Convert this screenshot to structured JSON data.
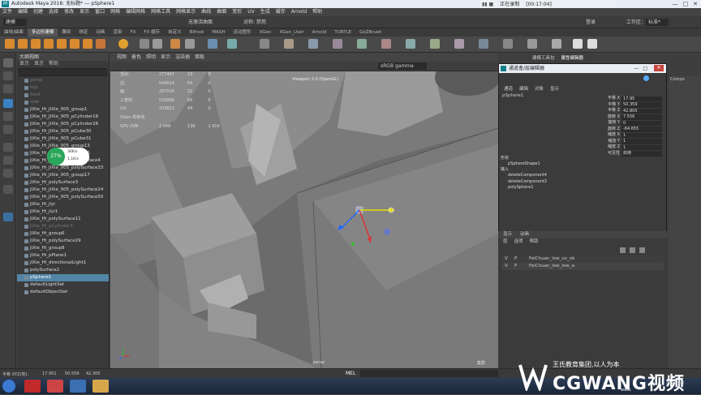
{
  "window": {
    "title": "Autodesk Maya 2018: 无标题*  ---  pSphere1",
    "controls": [
      "—",
      "□",
      "✕"
    ]
  },
  "recorder": {
    "status": "正在录制",
    "time": "[00:17:04]"
  },
  "menubar": [
    "文件",
    "编辑",
    "创建",
    "选择",
    "修改",
    "显示",
    "窗口",
    "网格",
    "编辑网格",
    "网格工具",
    "网格显示",
    "曲线",
    "曲面",
    "变形",
    "UV",
    "生成",
    "缓存",
    "Arnold",
    "帮助"
  ],
  "statusline": {
    "mode": "建模",
    "nolive": "无激活曲面",
    "symmetry": "对称: 禁用",
    "login": "登录",
    "workspace": "工作区：",
    "workspace_value": "标准*"
  },
  "shelf_tabs": [
    "曲线/曲面",
    "多边形建模",
    "雕刻",
    "绑定",
    "动画",
    "渲染",
    "FX",
    "FX 缓存",
    "自定义",
    "Bifrost",
    "MASH",
    "运动图形",
    "XGen",
    "XGen_User",
    "Arnold",
    "TURTLE",
    "GoZBrush"
  ],
  "shelf_active": "多边形建模",
  "outliner": {
    "title": "大纲视图",
    "menu": [
      "显示",
      "显示",
      "帮助"
    ],
    "items": [
      {
        "label": "persp",
        "dim": true
      },
      {
        "label": "top",
        "dim": true
      },
      {
        "label": "front",
        "dim": true
      },
      {
        "label": "side",
        "dim": true
      },
      {
        "label": "JiXie_Hi_JiXie_005_group1"
      },
      {
        "label": "JiXie_Hi_JiXie_005_pCylinder18"
      },
      {
        "label": "JiXie_Hi_JiXie_005_pCylinder26"
      },
      {
        "label": "JiXie_Hi_JiXie_005_pCube30"
      },
      {
        "label": "JiXie_Hi_JiXie_005_pCube31"
      },
      {
        "label": "JiXie_Hi_JiXie_005_group13"
      },
      {
        "label": "JiXie_Hi_JiXie_005_group16"
      },
      {
        "label": "JiXie_Hi_JiXie_005_polySurface4"
      },
      {
        "label": "JiXie_Hi_JiXie_005_polySurface33"
      },
      {
        "label": "JiXie_Hi_JiXie_005_group17"
      },
      {
        "label": "JiXie_Hi_polySurface3"
      },
      {
        "label": "JiXie_Hi_JiXie_005_polySurface24"
      },
      {
        "label": "JiXie_Hi_JiXie_005_polySurface50"
      },
      {
        "label": "JiXie_Hi_jiyi"
      },
      {
        "label": "JiXie_Hi_jiyi1"
      },
      {
        "label": "JiXie_Hi_polySurface11"
      },
      {
        "label": "JiXie_Hi_pCylinder3",
        "dim": true
      },
      {
        "label": "JiXie_Hi_group6"
      },
      {
        "label": "JiXie_Hi_polySurface29"
      },
      {
        "label": "JiXie_Hi_group8"
      },
      {
        "label": "JiXie_Hi_pPlane1"
      },
      {
        "label": "JiXie_Hi_directionalLight1"
      },
      {
        "label": "polySurface2"
      },
      {
        "label": "pSphere1",
        "selected": true
      },
      {
        "label": "defaultLightSet"
      },
      {
        "label": "defaultObjectSet"
      }
    ]
  },
  "perf": {
    "percent": "27%",
    "up": "36K/s",
    "down": "1.1K/s"
  },
  "viewport": {
    "menu": [
      "视图",
      "着色",
      "照明",
      "显示",
      "渲染器",
      "面板"
    ],
    "colorspace": "sRGB gamma",
    "hud": [
      {
        "k": "顶点:",
        "a": "277497",
        "b": "33",
        "c": "0"
      },
      {
        "k": "边:",
        "a": "544024",
        "b": "64",
        "c": "0"
      },
      {
        "k": "面:",
        "a": "267016",
        "b": "32",
        "c": "0"
      },
      {
        "k": "三角形:",
        "a": "533066",
        "b": "66",
        "c": "0"
      },
      {
        "k": "UV:",
        "a": "293823",
        "b": "44",
        "c": "0"
      },
      {
        "k": "XGen 样条线:",
        "a": "",
        "b": "",
        "c": ""
      },
      {
        "k": "GPU 内存:",
        "a": "2 048",
        "b": "136",
        "c": "1 916"
      }
    ],
    "renderer": "Viewport 2.0 (OpenGL)",
    "camera": "persp",
    "corner": "集群"
  },
  "right_tabs": [
    "建模工具包",
    "属性编辑器"
  ],
  "attr_editor": {
    "title": "通道盒/层编辑器",
    "menu": [
      "通道",
      "编辑",
      "对象",
      "显示"
    ],
    "object": "pSphere1",
    "channels": [
      {
        "label": "平移 X",
        "value": "17.95"
      },
      {
        "label": "平移 Y",
        "value": "50.359"
      },
      {
        "label": "平移 Z",
        "value": "42.805"
      },
      {
        "label": "旋转 X",
        "value": "7.556"
      },
      {
        "label": "旋转 Y",
        "value": "0"
      },
      {
        "label": "旋转 Z",
        "value": "-64.655"
      },
      {
        "label": "缩放 X",
        "value": "1"
      },
      {
        "label": "缩放 Y",
        "value": "1"
      },
      {
        "label": "缩放 Z",
        "value": "1"
      },
      {
        "label": "可见性",
        "value": "启用"
      }
    ],
    "shapes_header": "形状",
    "shape": "pSphereShape1",
    "inputs_header": "输入",
    "inputs": [
      "deleteComponent4",
      "deleteComponent3",
      "polySphere1"
    ]
  },
  "layers": {
    "tabs": [
      "显示",
      "动画"
    ],
    "menu": [
      "层",
      "选项",
      "帮助"
    ],
    "rows": [
      {
        "v": "V",
        "p": "P",
        "name": "FeiChuan_low_uv_ok"
      },
      {
        "v": "V",
        "p": "P",
        "name": "FeiChuan_low_low_a"
      }
    ]
  },
  "partial_right": {
    "label1": "Compo",
    "label2": "0 ■"
  },
  "timebar": {
    "label": "平移 XYZ(地):",
    "x": "17.951",
    "y": "50.559",
    "z": "42.305",
    "mel": "MEL"
  },
  "logo": {
    "top": "王氏教育集团,以人为本",
    "brand": "CGWANG视频",
    "site": "www.",
    "date": "2018/9/2"
  }
}
